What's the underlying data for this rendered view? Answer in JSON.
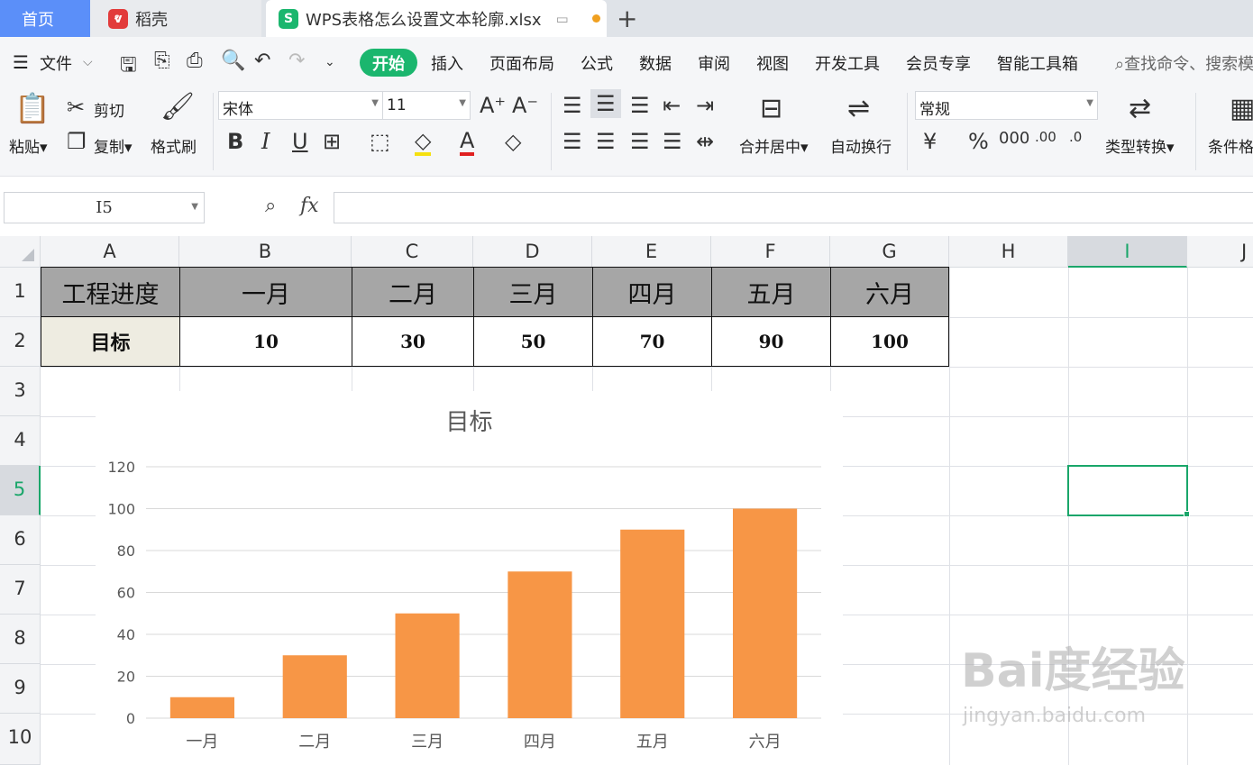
{
  "tabs": {
    "home": "首页",
    "daoke": "稻壳",
    "file": "WPS表格怎么设置文本轮廓.xlsx",
    "new_tab": "+"
  },
  "menu": {
    "file": "文件",
    "start": "开始",
    "items": [
      "插入",
      "页面布局",
      "公式",
      "数据",
      "审阅",
      "视图",
      "开发工具",
      "会员专享",
      "智能工具箱"
    ],
    "search": "查找命令、搜索模"
  },
  "ribbon": {
    "paste": "粘贴",
    "cut": "剪切",
    "copy": "复制",
    "format_painter": "格式刷",
    "font_name": "宋体",
    "font_size": "11",
    "merge_center": "合并居中",
    "wrap_text": "自动换行",
    "number_format": "常规",
    "type_convert": "类型转换",
    "conditional_format": "条件格式"
  },
  "formula_bar": {
    "name_box": "I5",
    "fx": "fx",
    "formula": ""
  },
  "columns": [
    "A",
    "B",
    "C",
    "D",
    "E",
    "F",
    "G",
    "H",
    "I",
    "J"
  ],
  "rows": [
    "1",
    "2",
    "3",
    "4",
    "5",
    "6",
    "7",
    "8",
    "9",
    "10"
  ],
  "table": {
    "header": [
      "工程进度",
      "一月",
      "二月",
      "三月",
      "四月",
      "五月",
      "六月"
    ],
    "row2": [
      "目标",
      "10",
      "30",
      "50",
      "70",
      "90",
      "100"
    ]
  },
  "chart_data": {
    "type": "bar",
    "title": "目标",
    "categories": [
      "一月",
      "二月",
      "三月",
      "四月",
      "五月",
      "六月"
    ],
    "series": [
      {
        "values": [
          10,
          30,
          50,
          70,
          90,
          100
        ]
      }
    ],
    "ylim": [
      0,
      120
    ],
    "yticks": [
      "0",
      "20",
      "40",
      "60",
      "80",
      "100",
      "120"
    ],
    "xlabel": "",
    "ylabel": "",
    "grid": true,
    "bar_color": "#f79646"
  },
  "watermark": {
    "text": "Bai度经验",
    "sub": "jingyan.baidu.com"
  },
  "colors": {
    "accent": "#1bb66e",
    "home_tab": "#5b8ff9",
    "header_fill": "#a6a6a6",
    "selection": "#1aa66a"
  }
}
